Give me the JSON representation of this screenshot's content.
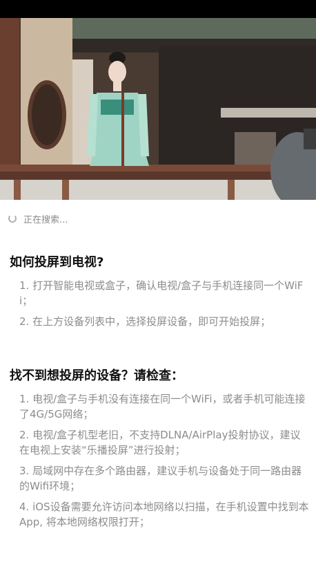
{
  "status": {
    "searching_text": "正在搜索..."
  },
  "help": {
    "title": "如何投屏到电视?",
    "steps": [
      "1. 打开智能电视或盒子，确认电视/盒子与手机连接同一个WiFi；",
      "2. 在上方设备列表中，选择投屏设备，即可开始投屏；"
    ]
  },
  "troubleshoot": {
    "title": "找不到想投屏的设备？请检查：",
    "steps": [
      "1. 电视/盒子与手机没有连接在同一个WiFi，或者手机可能连接了4G/5G网络；",
      "2. 电视/盒子机型老旧，不支持DLNA/AirPlay投射协议，建议在电视上安装“乐播投屏”进行投射；",
      "3. 局域网中存在多个路由器，建议手机与设备处于同一路由器的Wifi环境；",
      "4. iOS设备需要允许访问本地网络以扫描，在手机设置中找到本App, 将本地网络权限打开；"
    ]
  }
}
